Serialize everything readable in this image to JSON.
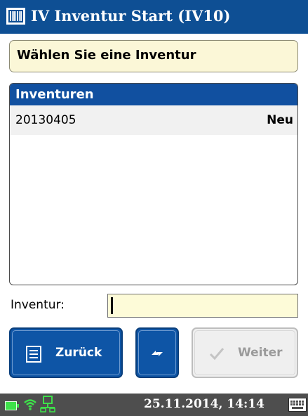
{
  "window": {
    "title": "IV Inventur Start (IV10)",
    "icon": "app-barcode-icon"
  },
  "instruction": {
    "text": "Wählen Sie eine Inventur"
  },
  "list": {
    "header": "Inventuren",
    "items": [
      {
        "id": "20130405",
        "status": "Neu"
      }
    ]
  },
  "input": {
    "label": "Inventur:",
    "value": "",
    "placeholder": ""
  },
  "buttons": {
    "back": {
      "label": "Zurück",
      "icon": "list-icon",
      "enabled": true
    },
    "refresh": {
      "icon": "refresh-icon",
      "enabled": true
    },
    "next": {
      "label": "Weiter",
      "icon": "checkmark-icon",
      "enabled": false
    }
  },
  "statusbar": {
    "datetime": "25.11.2014, 14:14",
    "icons": [
      "battery-icon",
      "wifi-icon",
      "network-icon",
      "keyboard-icon"
    ]
  },
  "colors": {
    "titlebar": "#0e4f94",
    "accent": "#1150a0",
    "input_background": "#fdfbd8",
    "instruction_background": "#fbf7d7",
    "status_green": "#3ee04a",
    "statusbar": "#4e4e4e"
  }
}
